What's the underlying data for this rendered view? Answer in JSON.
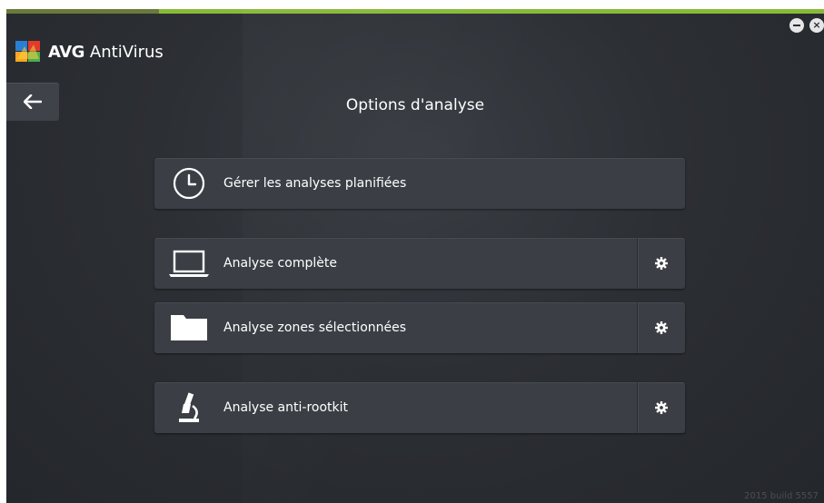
{
  "app": {
    "brand": "AVG",
    "product": "AntiVirus",
    "build": "2015 build 5557"
  },
  "page": {
    "title": "Options d'analyse"
  },
  "actions": [
    {
      "label": "Gérer les analyses planifiées",
      "icon": "clock-icon",
      "has_settings": false
    },
    {
      "label": "Analyse complète",
      "icon": "laptop-icon",
      "has_settings": true
    },
    {
      "label": "Analyse zones sélectionnées",
      "icon": "folder-icon",
      "has_settings": true
    },
    {
      "label": "Analyse anti-rootkit",
      "icon": "microscope-icon",
      "has_settings": true
    }
  ],
  "colors": {
    "background": "#2c2f34",
    "button": "#3b3f45",
    "accent_green": "#8ab93a",
    "text": "#ffffff"
  }
}
